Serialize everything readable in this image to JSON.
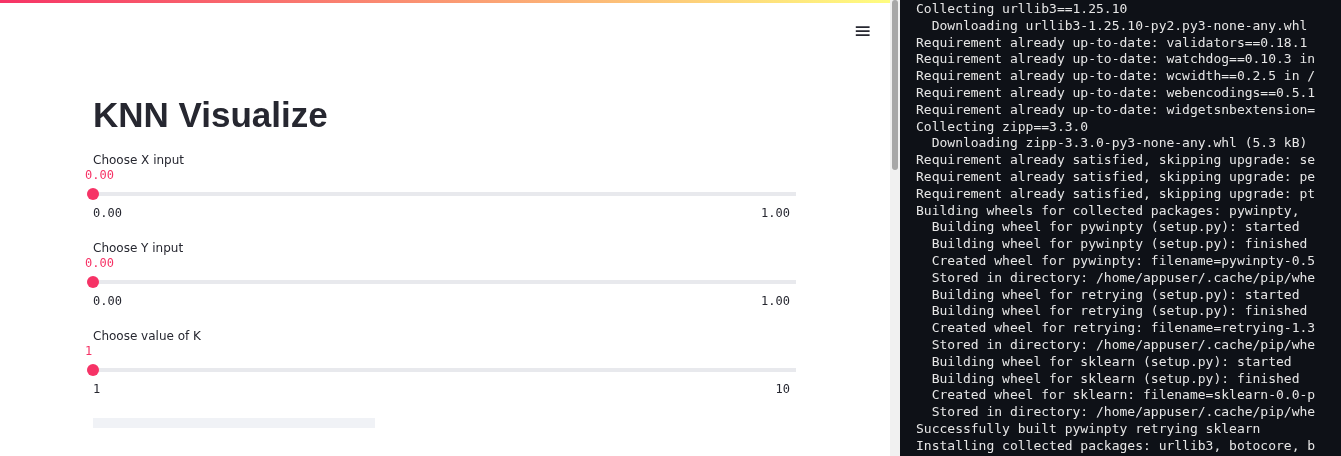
{
  "app": {
    "title": "KNN Visualize",
    "menu_icon": "≡",
    "sliders": [
      {
        "label": "Choose X input",
        "value": "0.00",
        "min": "0.00",
        "max": "1.00",
        "level": 0
      },
      {
        "label": "Choose Y input",
        "value": "0.00",
        "min": "0.00",
        "max": "1.00",
        "level": 0
      },
      {
        "label": "Choose value of K",
        "value": "1",
        "min": "1",
        "max": "10",
        "level": 0
      }
    ]
  },
  "terminal": {
    "lines": [
      "Collecting urllib3==1.25.10",
      "  Downloading urllib3-1.25.10-py2.py3-none-any.whl",
      "Requirement already up-to-date: validators==0.18.1",
      "Requirement already up-to-date: watchdog==0.10.3 in",
      "Requirement already up-to-date: wcwidth==0.2.5 in /",
      "Requirement already up-to-date: webencodings==0.5.1",
      "Requirement already up-to-date: widgetsnbextension=",
      "Collecting zipp==3.3.0",
      "  Downloading zipp-3.3.0-py3-none-any.whl (5.3 kB)",
      "Requirement already satisfied, skipping upgrade: se",
      "Requirement already satisfied, skipping upgrade: pe",
      "Requirement already satisfied, skipping upgrade: pt",
      "Building wheels for collected packages: pywinpty,",
      "  Building wheel for pywinpty (setup.py): started",
      "  Building wheel for pywinpty (setup.py): finished",
      "  Created wheel for pywinpty: filename=pywinpty-0.5",
      "  Stored in directory: /home/appuser/.cache/pip/whe",
      "  Building wheel for retrying (setup.py): started",
      "  Building wheel for retrying (setup.py): finished",
      "  Created wheel for retrying: filename=retrying-1.3",
      "  Stored in directory: /home/appuser/.cache/pip/whe",
      "  Building wheel for sklearn (setup.py): started",
      "  Building wheel for sklearn (setup.py): finished",
      "  Created wheel for sklearn: filename=sklearn-0.0-p",
      "  Stored in directory: /home/appuser/.cache/pip/whe",
      "Successfully built pywinpty retrying sklearn",
      "Installing collected packages: urllib3, botocore, b"
    ]
  }
}
